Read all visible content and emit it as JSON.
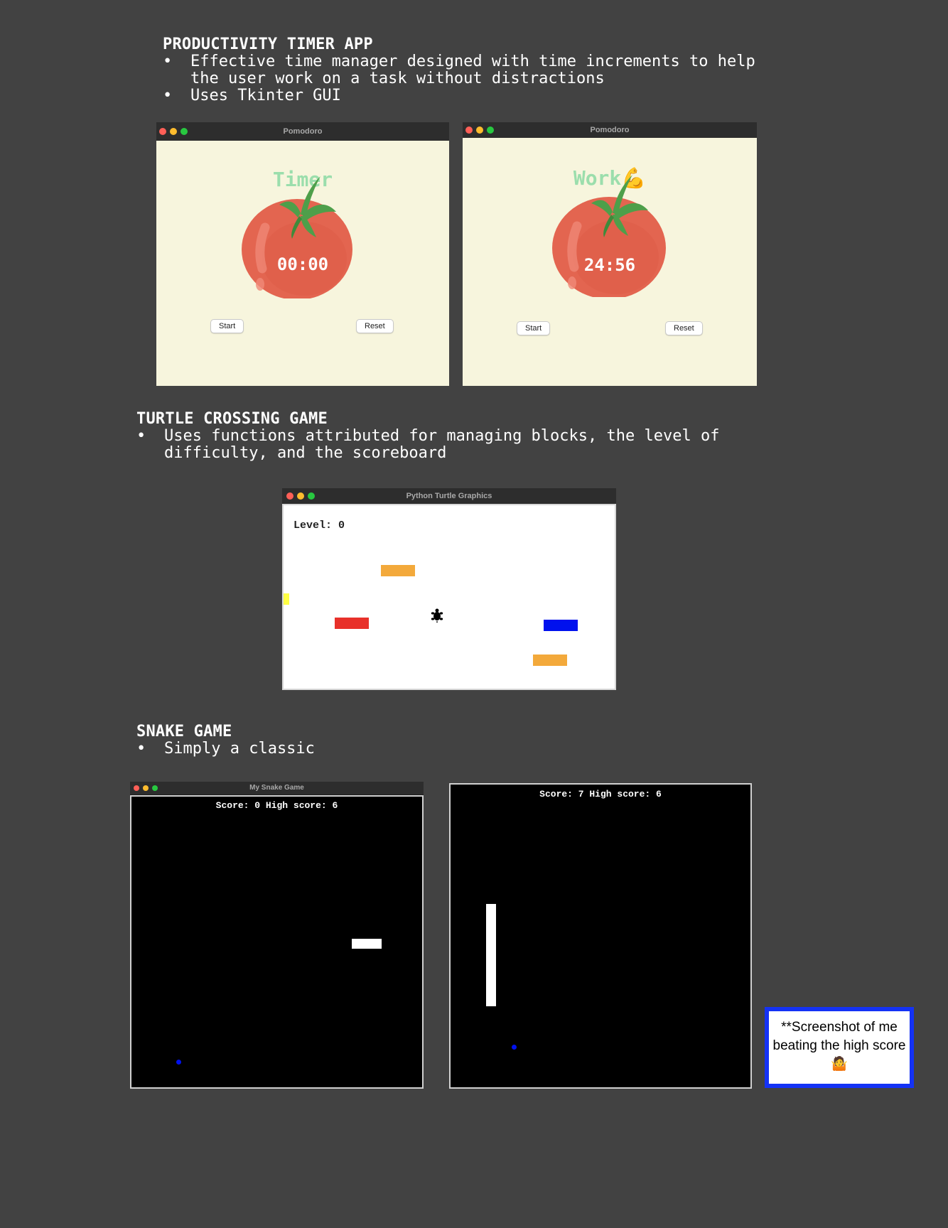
{
  "pomodoro_section": {
    "title": "PRODUCTIVITY TIMER APP",
    "bullets": [
      "Effective time manager designed with time increments to help the user work on a task without distractions",
      "Uses Tkinter GUI"
    ],
    "windows": [
      {
        "window_title": "Pomodoro",
        "heading": "Timer",
        "timer": "00:00",
        "start_label": "Start",
        "reset_label": "Reset"
      },
      {
        "window_title": "Pomodoro",
        "heading": "Work💪",
        "timer": "24:56",
        "start_label": "Start",
        "reset_label": "Reset"
      }
    ]
  },
  "turtle_section": {
    "title": "TURTLE CROSSING GAME",
    "bullets": [
      "Uses functions attributed for managing blocks, the level of difficulty, and the scoreboard"
    ],
    "window_title": "Python Turtle Graphics",
    "level_text": "Level: 0",
    "car_colors": [
      "#f3a93b",
      "#ffff44",
      "#e8312a",
      "#0011ee",
      "#f3a93b"
    ]
  },
  "snake_section": {
    "title": "SNAKE GAME",
    "bullets": [
      "Simply a classic"
    ],
    "window_title": "My Snake Game",
    "screens": [
      {
        "score_text": "Score: 0 High score: 6"
      },
      {
        "score_text": "Score: 7 High score: 6"
      }
    ],
    "note": "**Screenshot of me beating the high score 🤷"
  },
  "colors": {
    "page_bg": "#424242",
    "pomodoro_bg": "#f7f5dd",
    "pomodoro_green": "#9bdeac",
    "tomato_red": "#e36550",
    "snake_food": "#0011ee",
    "note_border": "#1432f5"
  }
}
